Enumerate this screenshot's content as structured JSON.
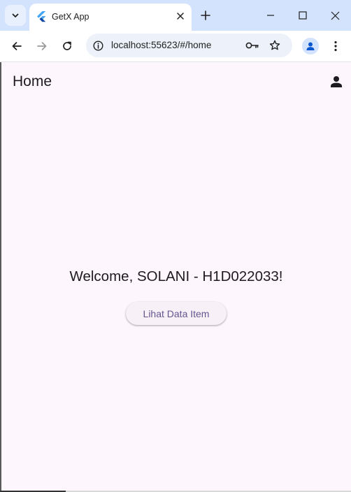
{
  "browser": {
    "tab_title": "GetX App",
    "url": "localhost:55623/#/home",
    "icons": {
      "tab_search": "chevron-down-icon",
      "favicon": "flutter-icon",
      "tab_close": "close-icon",
      "new_tab": "plus-icon",
      "minimize": "minimize-icon",
      "maximize": "maximize-icon",
      "close_window": "close-icon",
      "back": "arrow-left-icon",
      "forward": "arrow-right-icon",
      "reload": "reload-icon",
      "site_info": "info-icon",
      "password": "key-icon",
      "bookmark": "star-icon",
      "profile": "person-icon",
      "menu": "more-vertical-icon"
    }
  },
  "app": {
    "title": "Home",
    "welcome_text": "Welcome, SOLANI - H1D022033!",
    "data_button_label": "Lihat Data Item",
    "profile_icon": "person-icon",
    "colors": {
      "background": "#fdf7fd",
      "button_text": "#65558f",
      "text": "#1d1b20"
    }
  }
}
